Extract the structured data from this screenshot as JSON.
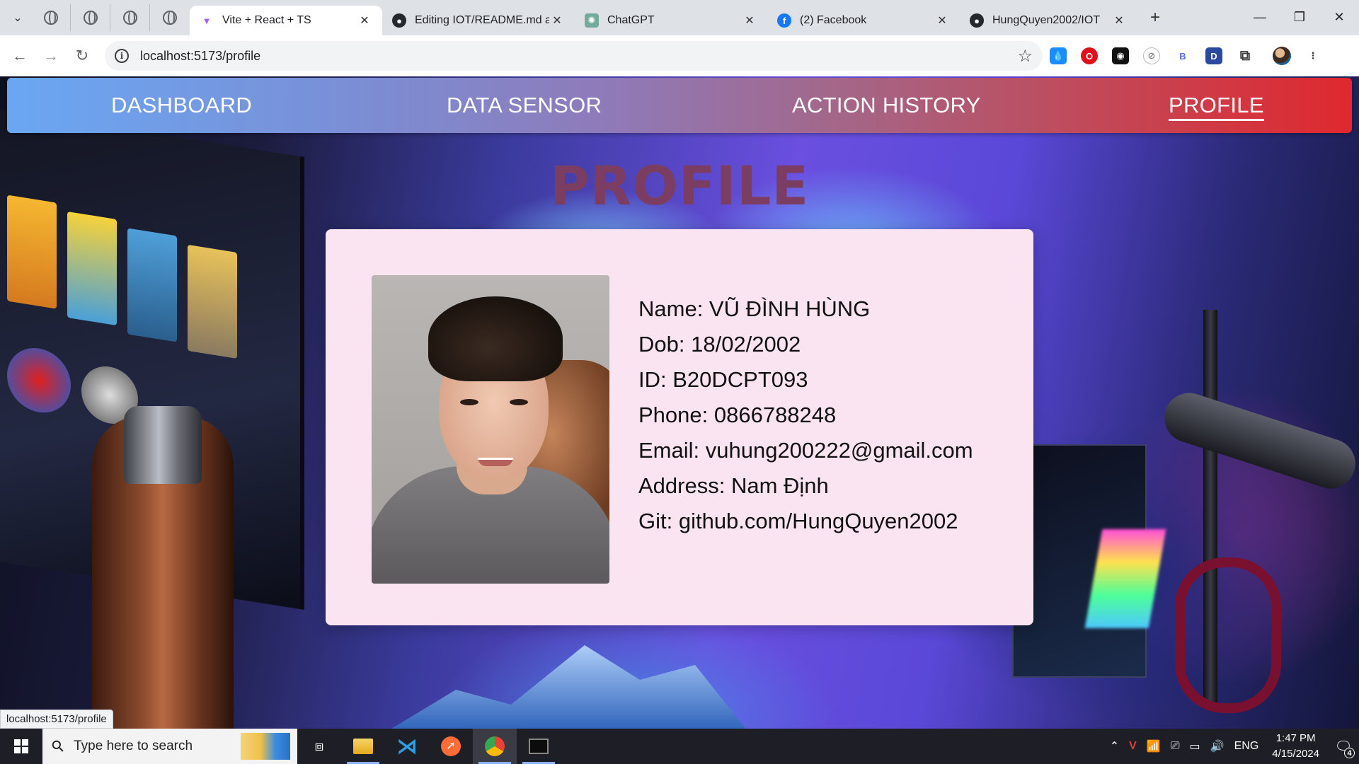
{
  "browser": {
    "tabs": [
      {
        "title": "Vite + React + TS",
        "icon": "vite-icon",
        "active": true
      },
      {
        "title": "Editing IOT/README.md at",
        "icon": "github-icon"
      },
      {
        "title": "ChatGPT",
        "icon": "chatgpt-icon"
      },
      {
        "title": "(2) Facebook",
        "icon": "facebook-icon"
      },
      {
        "title": "HungQuyen2002/IOT",
        "icon": "github-icon"
      }
    ],
    "url": "localhost:5173/profile",
    "status_url": "localhost:5173/profile"
  },
  "nav": {
    "items": [
      "DASHBOARD",
      "DATA SENSOR",
      "ACTION HISTORY",
      "PROFILE"
    ],
    "active": "PROFILE"
  },
  "page": {
    "title": "PROFILE",
    "profile": {
      "name": "Name: VŨ ĐÌNH HÙNG",
      "dob": "Dob: 18/02/2002",
      "id": "ID: B20DCPT093",
      "phone": "Phone: 0866788248",
      "email": "Email: vuhung200222@gmail.com",
      "address": "Address: Nam Định",
      "git": "Git: github.com/HungQuyen2002"
    }
  },
  "taskbar": {
    "search_placeholder": "Type here to search",
    "language": "ENG",
    "time": "1:47 PM",
    "date": "4/15/2024",
    "notifications": "4"
  },
  "colors": {
    "nav_gradient_start": "#6aa7f3",
    "nav_gradient_end": "#e0282e",
    "card_bg": "#fbe4f1",
    "title_color": "#7b3e62"
  }
}
